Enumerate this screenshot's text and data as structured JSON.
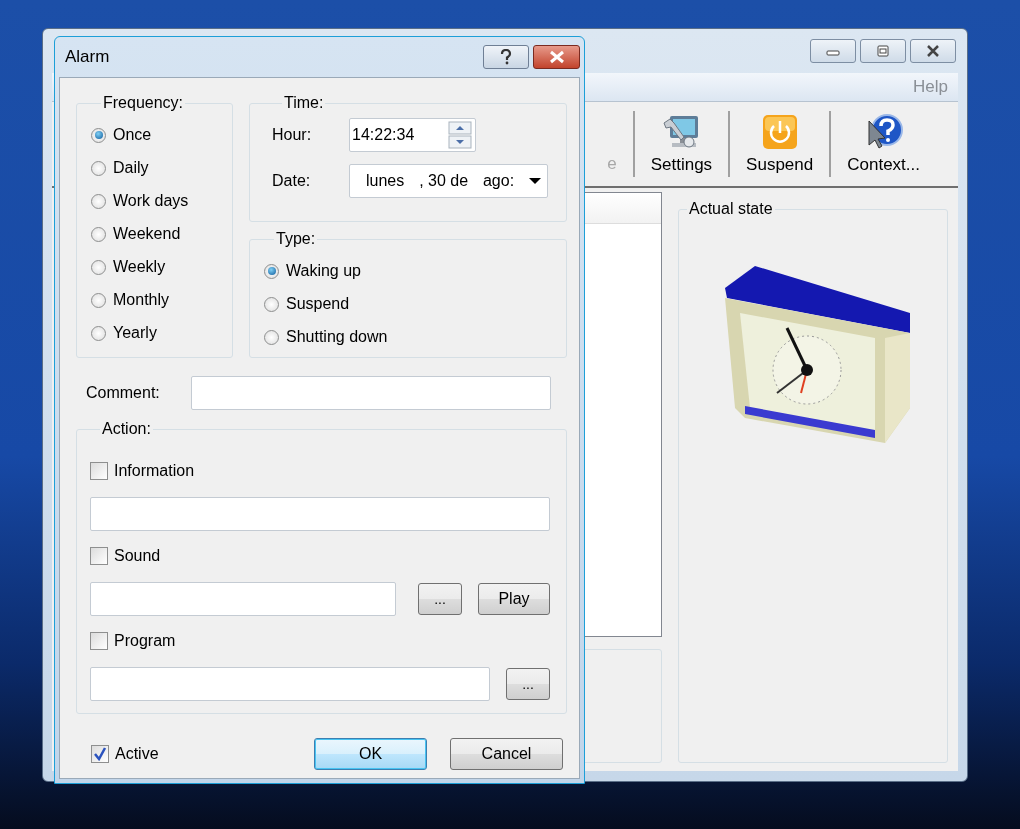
{
  "main_window": {
    "menu": [
      {
        "label": "Help"
      }
    ],
    "toolbar": [
      {
        "label": "e",
        "disabled": true
      },
      {
        "label": "Settings",
        "kind": "settings",
        "disabled": false
      },
      {
        "label": "Suspend",
        "kind": "power",
        "disabled": false
      },
      {
        "label": "Context...",
        "kind": "help",
        "disabled": false
      }
    ],
    "state_panel": {
      "title": "Actual state"
    }
  },
  "dialog": {
    "title": "Alarm",
    "frequency": {
      "title": "Frequency:",
      "options": [
        {
          "label": "Once",
          "selected": true
        },
        {
          "label": "Daily",
          "selected": false
        },
        {
          "label": "Work days",
          "selected": false
        },
        {
          "label": "Weekend",
          "selected": false
        },
        {
          "label": "Weekly",
          "selected": false
        },
        {
          "label": "Monthly",
          "selected": false
        },
        {
          "label": "Yearly",
          "selected": false
        }
      ]
    },
    "time": {
      "title": "Time:",
      "hour_label": "Hour:",
      "hour": "14:22:34",
      "date_label": "Date:",
      "date_parts": [
        "lunes",
        ", 30 de",
        "ago:"
      ]
    },
    "type": {
      "title": "Type:",
      "options": [
        {
          "label": "Waking up",
          "selected": true
        },
        {
          "label": "Suspend",
          "selected": false
        },
        {
          "label": "Shutting down",
          "selected": false
        }
      ]
    },
    "comment_label": "Comment:",
    "action": {
      "title": "Action:",
      "items": [
        {
          "label": "Information",
          "checked": false
        },
        {
          "label": "Sound",
          "checked": false,
          "buttons": [
            "...",
            "Play"
          ]
        },
        {
          "label": "Program",
          "checked": false,
          "buttons": [
            "..."
          ]
        }
      ]
    },
    "active": {
      "label": "Active",
      "checked": true
    },
    "buttons": [
      {
        "label": "OK",
        "default": true
      },
      {
        "label": "Cancel",
        "default": false
      }
    ]
  }
}
